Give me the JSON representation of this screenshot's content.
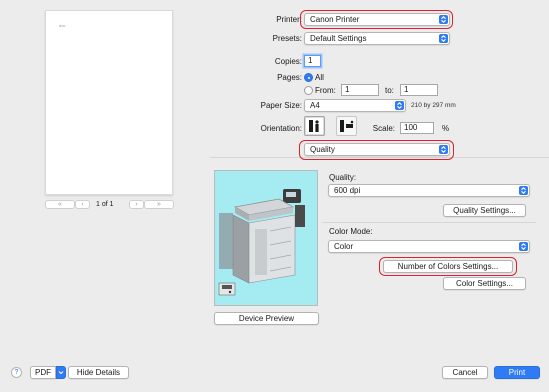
{
  "preview": {
    "page_counter": "1 of 1",
    "nav_first": "«",
    "nav_prev": "‹",
    "nav_next": "›",
    "nav_last": "»",
    "thumbnail_text": "doc",
    "device_preview_label": "Device Preview"
  },
  "printer": {
    "label": "Printer:",
    "value": "Canon Printer"
  },
  "presets": {
    "label": "Presets:",
    "value": "Default Settings"
  },
  "copies": {
    "label": "Copies:",
    "value": "1"
  },
  "pages": {
    "label": "Pages:",
    "all_label": "All",
    "from_label": "From:",
    "from_value": "1",
    "to_label": "to:",
    "to_value": "1"
  },
  "paper_size": {
    "label": "Paper Size:",
    "value": "A4",
    "dimensions": "210 by 297 mm"
  },
  "orientation": {
    "label": "Orientation:"
  },
  "scale": {
    "label": "Scale:",
    "value": "100",
    "unit": "%"
  },
  "section_popup": {
    "value": "Quality"
  },
  "quality": {
    "label": "Quality:",
    "value": "600 dpi",
    "settings_button": "Quality Settings..."
  },
  "color_mode": {
    "label": "Color Mode:",
    "value": "Color",
    "number_of_colors_button": "Number of Colors Settings...",
    "color_settings_button": "Color Settings..."
  },
  "footer": {
    "help": "?",
    "pdf": "PDF",
    "hide_details": "Hide Details",
    "cancel": "Cancel",
    "print": "Print"
  },
  "colors": {
    "accent": "#2f7bf6",
    "highlight_ring": "#e0202a"
  }
}
